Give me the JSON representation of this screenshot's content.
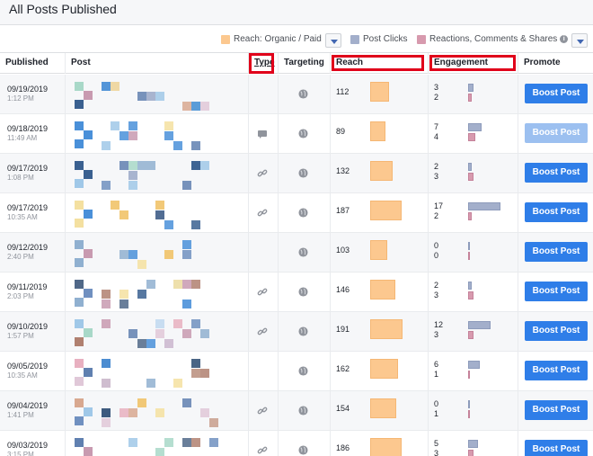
{
  "page_title": "All Posts Published",
  "legend": {
    "reach": "Reach: Organic / Paid",
    "clicks": "Post Clicks",
    "reactions": "Reactions, Comments & Shares",
    "info": "i",
    "colors": {
      "reach": "#fcc88f",
      "clicks": "#a3afcb",
      "reactions": "#d79aae"
    }
  },
  "columns": {
    "published": "Published",
    "post": "Post",
    "type": "Type",
    "targeting": "Targeting",
    "reach": "Reach",
    "engagement": "Engagement",
    "promote": "Promote"
  },
  "boost_label": "Boost Post",
  "rows": [
    {
      "date": "09/19/2019",
      "time": "1:12 PM",
      "type": "none",
      "reach": "112",
      "clicks": "3",
      "reactions": "2",
      "reach_val": 112,
      "clicks_val": 3,
      "react_val": 2,
      "boost_enabled": true
    },
    {
      "date": "09/18/2019",
      "time": "11:49 AM",
      "type": "comment",
      "reach": "89",
      "clicks": "7",
      "reactions": "4",
      "reach_val": 89,
      "clicks_val": 7,
      "react_val": 4,
      "boost_enabled": false
    },
    {
      "date": "09/17/2019",
      "time": "1:08 PM",
      "type": "link",
      "reach": "132",
      "clicks": "2",
      "reactions": "3",
      "reach_val": 132,
      "clicks_val": 2,
      "react_val": 3,
      "boost_enabled": true
    },
    {
      "date": "09/17/2019",
      "time": "10:35 AM",
      "type": "link",
      "reach": "187",
      "clicks": "17",
      "reactions": "2",
      "reach_val": 187,
      "clicks_val": 17,
      "react_val": 2,
      "boost_enabled": true
    },
    {
      "date": "09/12/2019",
      "time": "2:40 PM",
      "type": "none",
      "reach": "103",
      "clicks": "0",
      "reactions": "0",
      "reach_val": 103,
      "clicks_val": 0,
      "react_val": 0,
      "boost_enabled": true
    },
    {
      "date": "09/11/2019",
      "time": "2:03 PM",
      "type": "link",
      "reach": "146",
      "clicks": "2",
      "reactions": "3",
      "reach_val": 146,
      "clicks_val": 2,
      "react_val": 3,
      "boost_enabled": true
    },
    {
      "date": "09/10/2019",
      "time": "1:57 PM",
      "type": "link",
      "reach": "191",
      "clicks": "12",
      "reactions": "3",
      "reach_val": 191,
      "clicks_val": 12,
      "react_val": 3,
      "boost_enabled": true
    },
    {
      "date": "09/05/2019",
      "time": "10:35 AM",
      "type": "none",
      "reach": "162",
      "clicks": "6",
      "reactions": "1",
      "reach_val": 162,
      "clicks_val": 6,
      "react_val": 1,
      "boost_enabled": true
    },
    {
      "date": "09/04/2019",
      "time": "1:41 PM",
      "type": "link",
      "reach": "154",
      "clicks": "0",
      "reactions": "1",
      "reach_val": 154,
      "clicks_val": 0,
      "react_val": 1,
      "boost_enabled": true
    },
    {
      "date": "09/03/2019",
      "time": "3:15 PM",
      "type": "link",
      "reach": "186",
      "clicks": "5",
      "reactions": "3",
      "reach_val": 186,
      "clicks_val": 5,
      "react_val": 3,
      "boost_enabled": true
    }
  ]
}
